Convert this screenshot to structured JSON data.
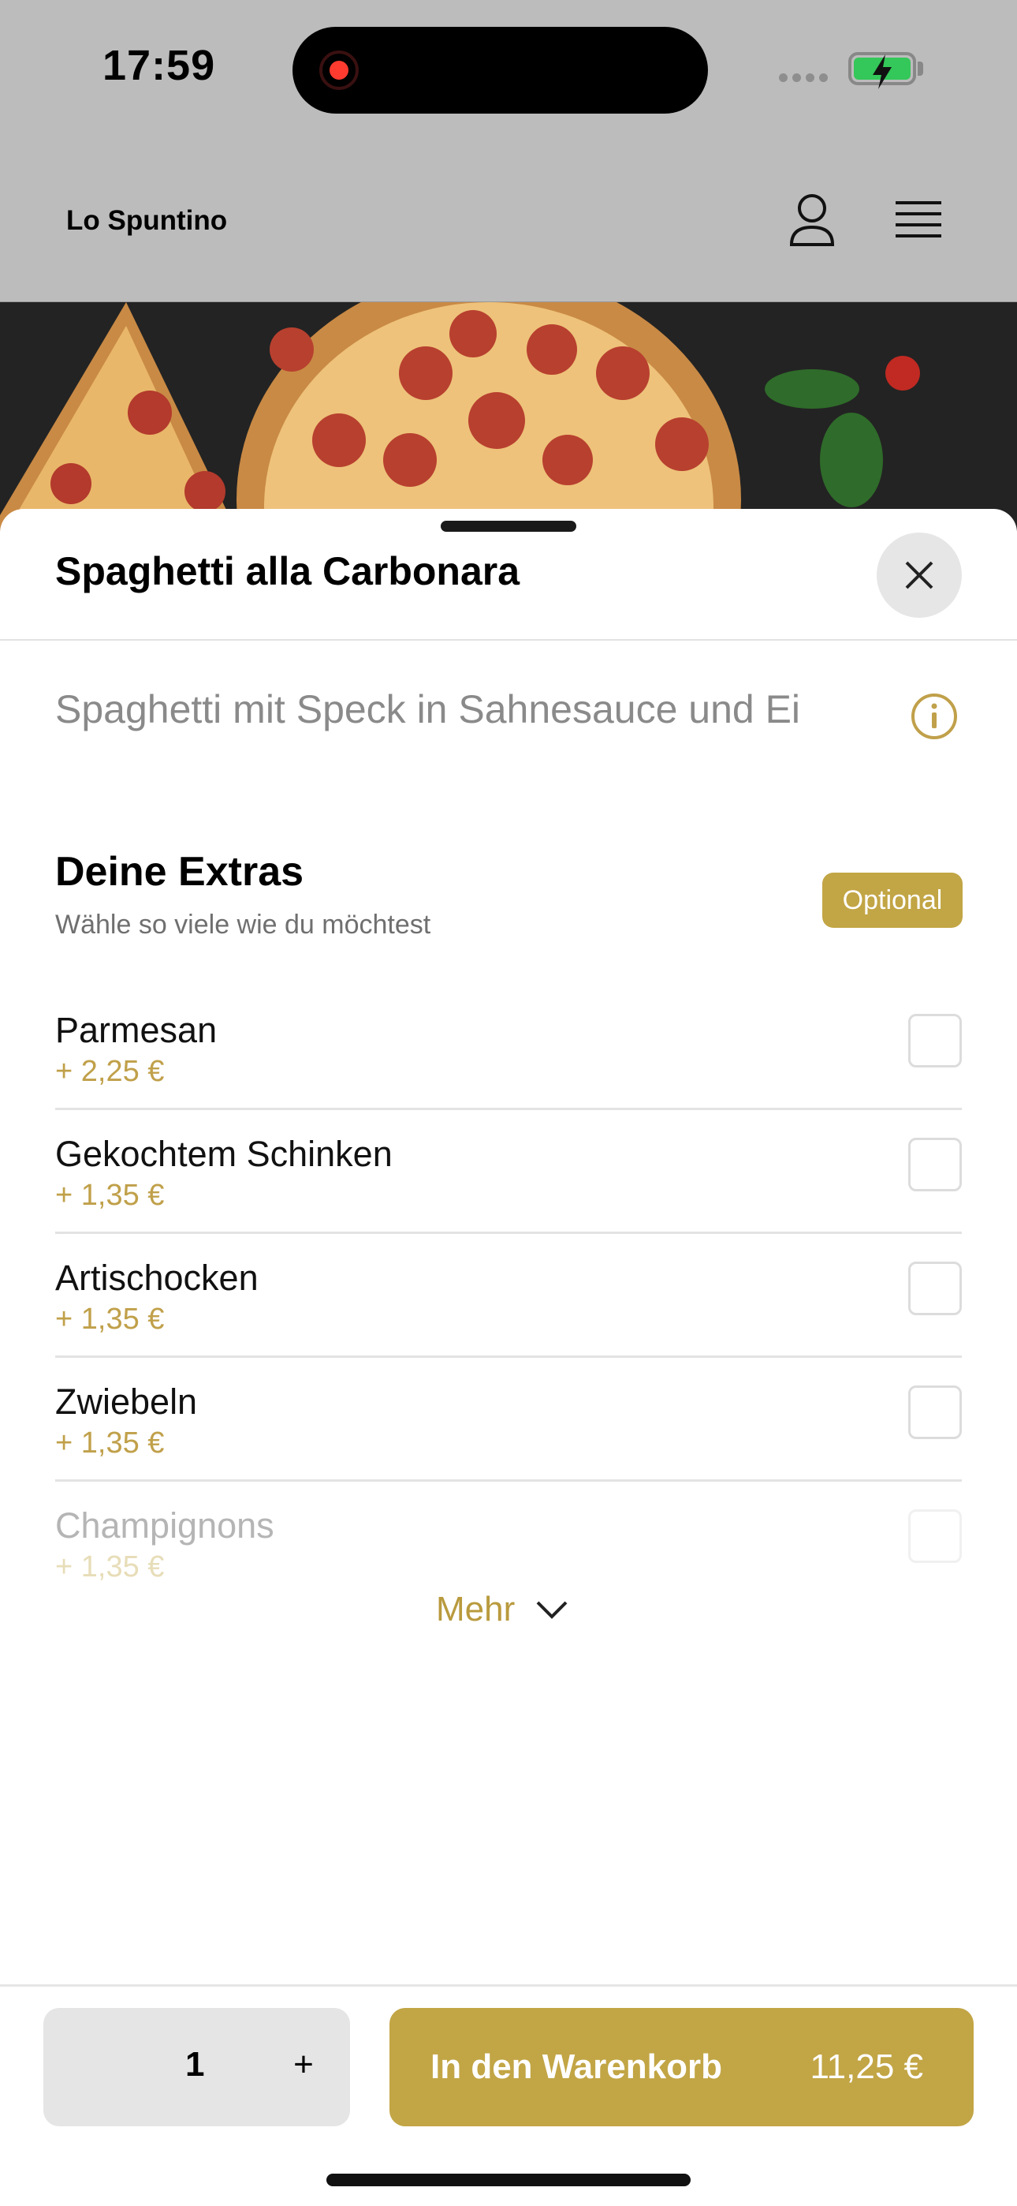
{
  "status_bar": {
    "time": "17:59"
  },
  "header": {
    "brand": "Lo Spuntino"
  },
  "sheet": {
    "title": "Spaghetti alla Carbonara",
    "description": "Spaghetti mit Speck in Sahnesauce und Ei"
  },
  "extras": {
    "title": "Deine Extras",
    "subtitle": "Wähle so viele wie du möchtest",
    "badge": "Optional",
    "options": [
      {
        "name": "Parmesan",
        "price": "+ 2,25 €",
        "checked": false
      },
      {
        "name": "Gekochtem Schinken",
        "price": "+ 1,35 €",
        "checked": false
      },
      {
        "name": "Artischocken",
        "price": "+ 1,35 €",
        "checked": false
      },
      {
        "name": "Zwiebeln",
        "price": "+ 1,35 €",
        "checked": false
      },
      {
        "name": "Champignons",
        "price": "+ 1,35 €",
        "checked": false
      }
    ],
    "more_label": "Mehr"
  },
  "cart": {
    "quantity": "1",
    "plus": "+",
    "add_label": "In den Warenkorb",
    "total": "11,25 €"
  },
  "colors": {
    "accent": "#c2a545",
    "price": "#c0a04a",
    "header_bg": "#bcbcbc"
  }
}
